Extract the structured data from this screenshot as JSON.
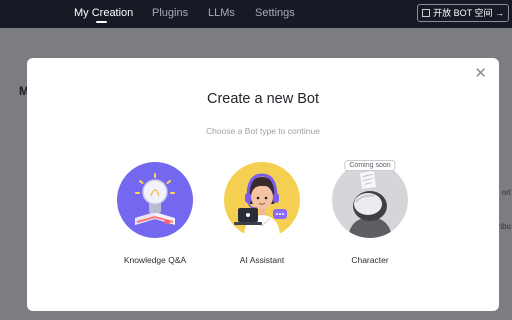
{
  "nav": {
    "items": [
      {
        "label": "My Creation",
        "active": true
      },
      {
        "label": "Plugins",
        "active": false
      },
      {
        "label": "LLMs",
        "active": false
      },
      {
        "label": "Settings",
        "active": false
      }
    ],
    "bot_link": "开放 BOT 空间 →"
  },
  "background": {
    "heading_initial": "M",
    "right_fragments": [
      "ort",
      "nbu"
    ]
  },
  "modal": {
    "title": "Create a new Bot",
    "subtitle": "Choose a Bot type to continue",
    "close_icon": "close-icon",
    "options": [
      {
        "label": "Knowledge Q&A",
        "icon": "lightbulb-book-icon",
        "color": "#7467f0"
      },
      {
        "label": "AI Assistant",
        "icon": "assistant-headset-icon",
        "color": "#f5cf52"
      },
      {
        "label": "Character",
        "icon": "character-figure-icon",
        "color": "#d5d6d9",
        "badge": "Coming soon"
      }
    ]
  },
  "colors": {
    "topbar": "#171924",
    "backdrop": "#7c7d82",
    "modal": "#ffffff"
  }
}
